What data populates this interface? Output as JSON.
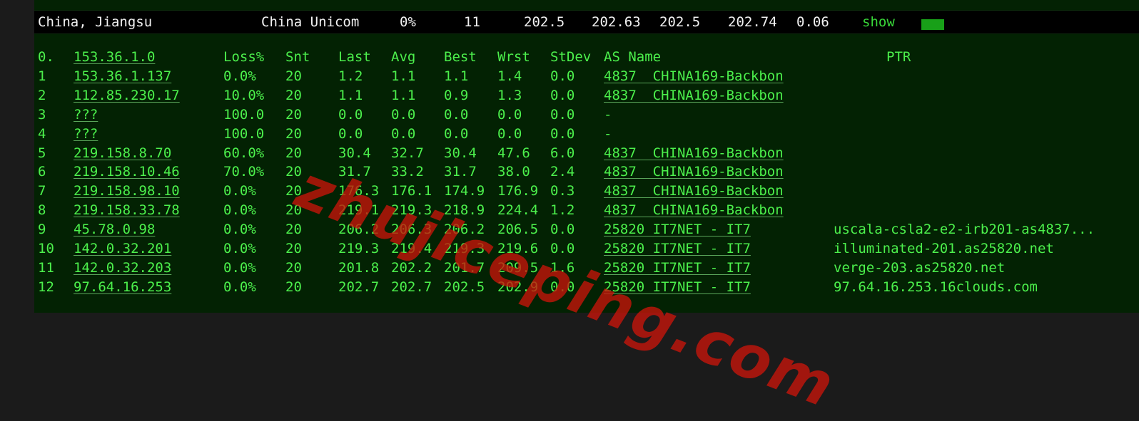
{
  "summary": {
    "location": "China, Jiangsu",
    "isp": "China Unicom",
    "loss": "0%",
    "hops": "11",
    "v1": "202.5",
    "v2": "202.63",
    "v3": "202.5",
    "v4": "202.74",
    "v5": "0.06",
    "show_label": "show"
  },
  "headers": {
    "hop": "0.",
    "host": "153.36.1.0",
    "loss": "Loss%",
    "snt": "Snt",
    "last": "Last",
    "avg": "Avg",
    "best": "Best",
    "wrst": "Wrst",
    "stdev": "StDev",
    "as": "AS Name",
    "ptr": "PTR"
  },
  "rows": [
    {
      "hop": "1",
      "host": "153.36.1.137",
      "loss": "0.0%",
      "snt": "20",
      "last": "1.2",
      "avg": "1.1",
      "best": "1.1",
      "wrst": "1.4",
      "stdev": "0.0",
      "as": "4837  CHINA169-Backbon",
      "ptr": ""
    },
    {
      "hop": "2",
      "host": "112.85.230.17",
      "loss": "10.0%",
      "snt": "20",
      "last": "1.1",
      "avg": "1.1",
      "best": "0.9",
      "wrst": "1.3",
      "stdev": "0.0",
      "as": "4837  CHINA169-Backbon",
      "ptr": ""
    },
    {
      "hop": "3",
      "host": "???",
      "loss": "100.0",
      "snt": "20",
      "last": "0.0",
      "avg": "0.0",
      "best": "0.0",
      "wrst": "0.0",
      "stdev": "0.0",
      "as": "-",
      "ptr": ""
    },
    {
      "hop": "4",
      "host": "???",
      "loss": "100.0",
      "snt": "20",
      "last": "0.0",
      "avg": "0.0",
      "best": "0.0",
      "wrst": "0.0",
      "stdev": "0.0",
      "as": "-",
      "ptr": ""
    },
    {
      "hop": "5",
      "host": "219.158.8.70",
      "loss": "60.0%",
      "snt": "20",
      "last": "30.4",
      "avg": "32.7",
      "best": "30.4",
      "wrst": "47.6",
      "stdev": "6.0",
      "as": "4837  CHINA169-Backbon",
      "ptr": ""
    },
    {
      "hop": "6",
      "host": "219.158.10.46",
      "loss": "70.0%",
      "snt": "20",
      "last": "31.7",
      "avg": "33.2",
      "best": "31.7",
      "wrst": "38.0",
      "stdev": "2.4",
      "as": "4837  CHINA169-Backbon",
      "ptr": ""
    },
    {
      "hop": "7",
      "host": "219.158.98.10",
      "loss": "0.0%",
      "snt": "20",
      "last": "176.3",
      "avg": "176.1",
      "best": "174.9",
      "wrst": "176.9",
      "stdev": "0.3",
      "as": "4837  CHINA169-Backbon",
      "ptr": ""
    },
    {
      "hop": "8",
      "host": "219.158.33.78",
      "loss": "0.0%",
      "snt": "20",
      "last": "219.1",
      "avg": "219.3",
      "best": "218.9",
      "wrst": "224.4",
      "stdev": "1.2",
      "as": "4837  CHINA169-Backbon",
      "ptr": ""
    },
    {
      "hop": "9",
      "host": "45.78.0.98",
      "loss": "0.0%",
      "snt": "20",
      "last": "206.2",
      "avg": "206.3",
      "best": "206.2",
      "wrst": "206.5",
      "stdev": "0.0",
      "as": "25820 IT7NET - IT7",
      "ptr": "uscala-csla2-e2-irb201-as4837..."
    },
    {
      "hop": "10",
      "host": "142.0.32.201",
      "loss": "0.0%",
      "snt": "20",
      "last": "219.3",
      "avg": "219.4",
      "best": "219.3",
      "wrst": "219.6",
      "stdev": "0.0",
      "as": "25820 IT7NET - IT7",
      "ptr": "illuminated-201.as25820.net"
    },
    {
      "hop": "11",
      "host": "142.0.32.203",
      "loss": "0.0%",
      "snt": "20",
      "last": "201.8",
      "avg": "202.2",
      "best": "201.7",
      "wrst": "209.5",
      "stdev": "1.6",
      "as": "25820 IT7NET - IT7",
      "ptr": "verge-203.as25820.net"
    },
    {
      "hop": "12",
      "host": "97.64.16.253",
      "loss": "0.0%",
      "snt": "20",
      "last": "202.7",
      "avg": "202.7",
      "best": "202.5",
      "wrst": "202.9",
      "stdev": "0.0",
      "as": "25820 IT7NET - IT7",
      "ptr": "97.64.16.253.16clouds.com"
    }
  ],
  "watermark": "zhujiceping.com",
  "colors": {
    "panel_bg": "#032203",
    "text_green": "#4cf04c",
    "summary_bg": "#000000",
    "watermark": "#c8140a"
  }
}
